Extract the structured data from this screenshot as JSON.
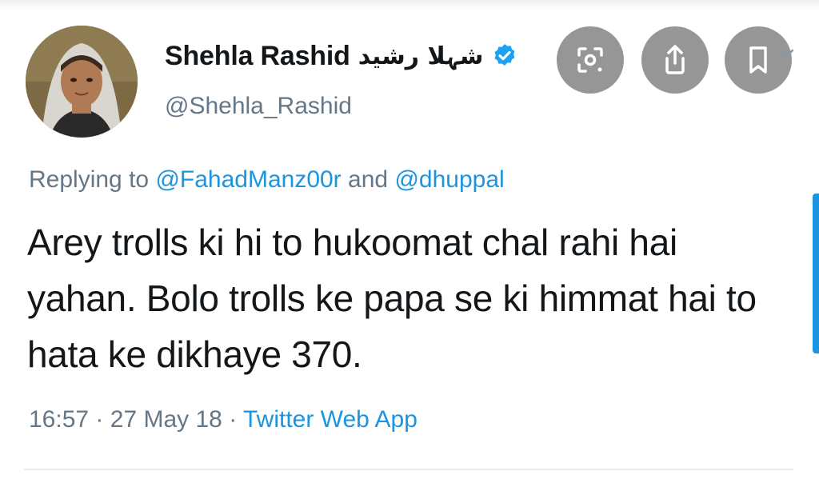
{
  "tweet": {
    "author": {
      "display_name": "Shehla Rashid",
      "display_name_urdu": "شہلا رشید",
      "handle": "@Shehla_Rashid",
      "verified": true
    },
    "reply": {
      "prefix": "Replying to",
      "mention_1": "@FahadManz00r",
      "connector": "and",
      "mention_2": "@dhuppal"
    },
    "text": "Arey trolls ki hi to hukoomat chal rahi hai yahan. Bolo trolls ke papa se ki himmat hai to hata ke dikhaye 370.",
    "time": "16:57",
    "separator": "·",
    "date": "27 May 18",
    "source": "Twitter Web App"
  },
  "overlay": {
    "icons": [
      "lens-search-icon",
      "share-icon",
      "bookmark-icon"
    ]
  },
  "colors": {
    "link": "#1b95e0",
    "secondary_text": "#657786",
    "primary_text": "#14171a",
    "verified_badge": "#1da1f2"
  }
}
